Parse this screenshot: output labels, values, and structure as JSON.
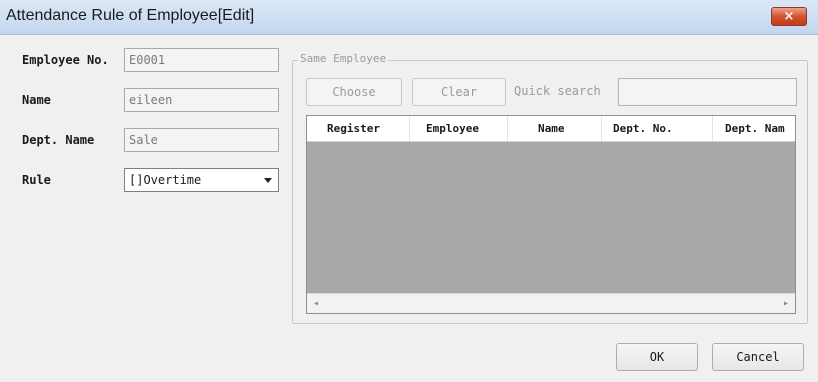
{
  "window": {
    "title": "Attendance Rule of Employee[Edit]",
    "close_glyph": "×"
  },
  "form": {
    "employee_no": {
      "label": "Employee No.",
      "value": "E0001"
    },
    "name": {
      "label": "Name",
      "value": "eileen"
    },
    "dept_name": {
      "label": "Dept. Name",
      "value": "Sale"
    },
    "rule": {
      "label": "Rule",
      "selected": "[]Overtime"
    }
  },
  "same_employee": {
    "group_title": "Same Employee",
    "choose_label": "Choose",
    "clear_label": "Clear",
    "quick_search_label": "Quick search",
    "quick_search_value": "",
    "columns": [
      "Register",
      "Employee",
      "Name",
      "Dept. No.",
      "Dept. Nam"
    ],
    "rows": [],
    "scroll_left_glyph": "◂",
    "scroll_right_glyph": "▸"
  },
  "footer": {
    "ok_label": "OK",
    "cancel_label": "Cancel"
  }
}
